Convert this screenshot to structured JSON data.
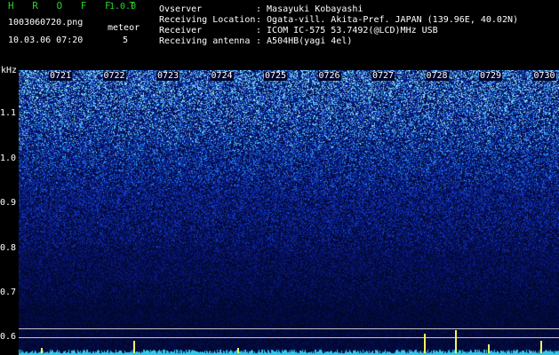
{
  "header": {
    "app_title": "H R O F F T",
    "version": "1.0.0",
    "filename": "1003060720.png",
    "datetime": "10.03.06 07:20",
    "meteor_label": "meteor",
    "meteor_count": "5",
    "fields": [
      {
        "label": "Ovserver",
        "value": ": Masayuki Kobayashi"
      },
      {
        "label": "Receiving Location",
        "value": ": Ogata-vill. Akita-Pref. JAPAN (139.96E, 40.02N)"
      },
      {
        "label": "Receiver",
        "value": ": ICOM IC-575 53.7492(@LCD)MHz USB"
      },
      {
        "label": "Receiving antenna",
        "value": ": A504HB(yagi 4el)"
      }
    ]
  },
  "axes": {
    "y_unit": "kHz",
    "y_ticks": [
      "1.1",
      "1.0",
      "0.9",
      "0.8",
      "0.7",
      "0.6"
    ],
    "x_ticks": [
      "0721",
      "0722",
      "0723",
      "0724",
      "0725",
      "0726",
      "0727",
      "0728",
      "0729",
      "0730"
    ]
  },
  "colors": {
    "background": "#000000",
    "header_accent": "#2bd12b",
    "spectrogram_low": "#000a3a",
    "spectrogram_high": "#4fd0ff",
    "meteor_echo": "#f2f25a"
  }
}
